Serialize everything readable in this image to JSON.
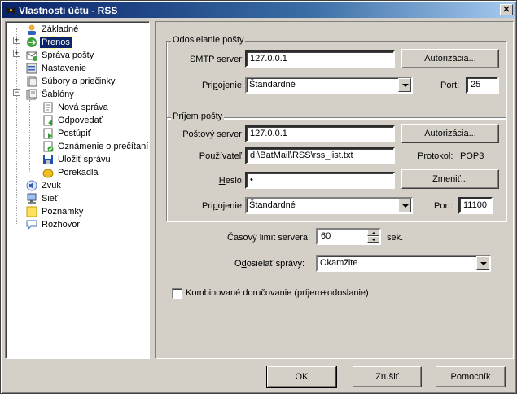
{
  "window": {
    "title": "Vlastnosti účtu - RSS",
    "close_glyph": "✕"
  },
  "tree": {
    "items": [
      {
        "label": "Základné",
        "icon": "user-icon"
      },
      {
        "label": "Prenos",
        "icon": "transfer-icon",
        "selected": true,
        "expander": "+"
      },
      {
        "label": "Správa pošty",
        "icon": "mail-management-icon",
        "expander": "+"
      },
      {
        "label": "Nastavenie",
        "icon": "settings-icon"
      },
      {
        "label": "Súbory a priečinky",
        "icon": "files-folders-icon"
      },
      {
        "label": "Šablóny",
        "icon": "templates-icon",
        "expander": "−"
      },
      {
        "label": "Nová správa",
        "icon": "new-message-icon",
        "child": true
      },
      {
        "label": "Odpovedať",
        "icon": "reply-icon",
        "child": true
      },
      {
        "label": "Postúpiť",
        "icon": "forward-icon",
        "child": true
      },
      {
        "label": "Oznámenie o prečítaní",
        "icon": "read-receipt-icon",
        "child": true
      },
      {
        "label": "Uložiť správu",
        "icon": "save-message-icon",
        "child": true
      },
      {
        "label": "Porekadlá",
        "icon": "sayings-icon",
        "child": true
      },
      {
        "label": "Zvuk",
        "icon": "sound-icon"
      },
      {
        "label": "Sieť",
        "icon": "network-icon"
      },
      {
        "label": "Poznámky",
        "icon": "notes-icon"
      },
      {
        "label": "Rozhovor",
        "icon": "chat-icon"
      }
    ]
  },
  "outgoing": {
    "title": "Odosielanie pošty",
    "smtp_label_u": "S",
    "smtp_label_rest": "MTP server:",
    "smtp_value": "127.0.0.1",
    "auth_button": "Autorizácia...",
    "connection_label_pre": "Pri",
    "connection_label_u": "p",
    "connection_label_post": "ojenie:",
    "connection_value": "Štandardné",
    "port_label": "Port:",
    "port_value": "25"
  },
  "incoming": {
    "title": "Príjem pošty",
    "server_label_u": "P",
    "server_label_rest": "oštový server:",
    "server_value": "127.0.0.1",
    "auth_button": "Autorizácia...",
    "user_label_pre": "Po",
    "user_label_u": "u",
    "user_label_post": "žívateľ:",
    "user_value": "d:\\BatMail\\RSS\\rss_list.txt",
    "protocol_label": "Protokol:",
    "protocol_value": "POP3",
    "password_label_u": "H",
    "password_label_rest": "eslo:",
    "password_value": "•",
    "change_button": "Zmeniť...",
    "connection_label_pre": "Pri",
    "connection_label_u": "p",
    "connection_label_post": "ojenie:",
    "connection_value": "Štandardné",
    "port_label": "Port:",
    "port_value": "11100"
  },
  "timeout": {
    "label": "Časový limit servera:",
    "value": "60",
    "unit": "sek."
  },
  "send": {
    "label_pre": "O",
    "label_u": "d",
    "label_post": "osielať správy:",
    "value": "Okamžite"
  },
  "combined": {
    "label": "Kombinované doručovanie (príjem+odoslanie)"
  },
  "buttons": {
    "ok": "OK",
    "cancel": "Zrušiť",
    "help": "Pomocník"
  }
}
